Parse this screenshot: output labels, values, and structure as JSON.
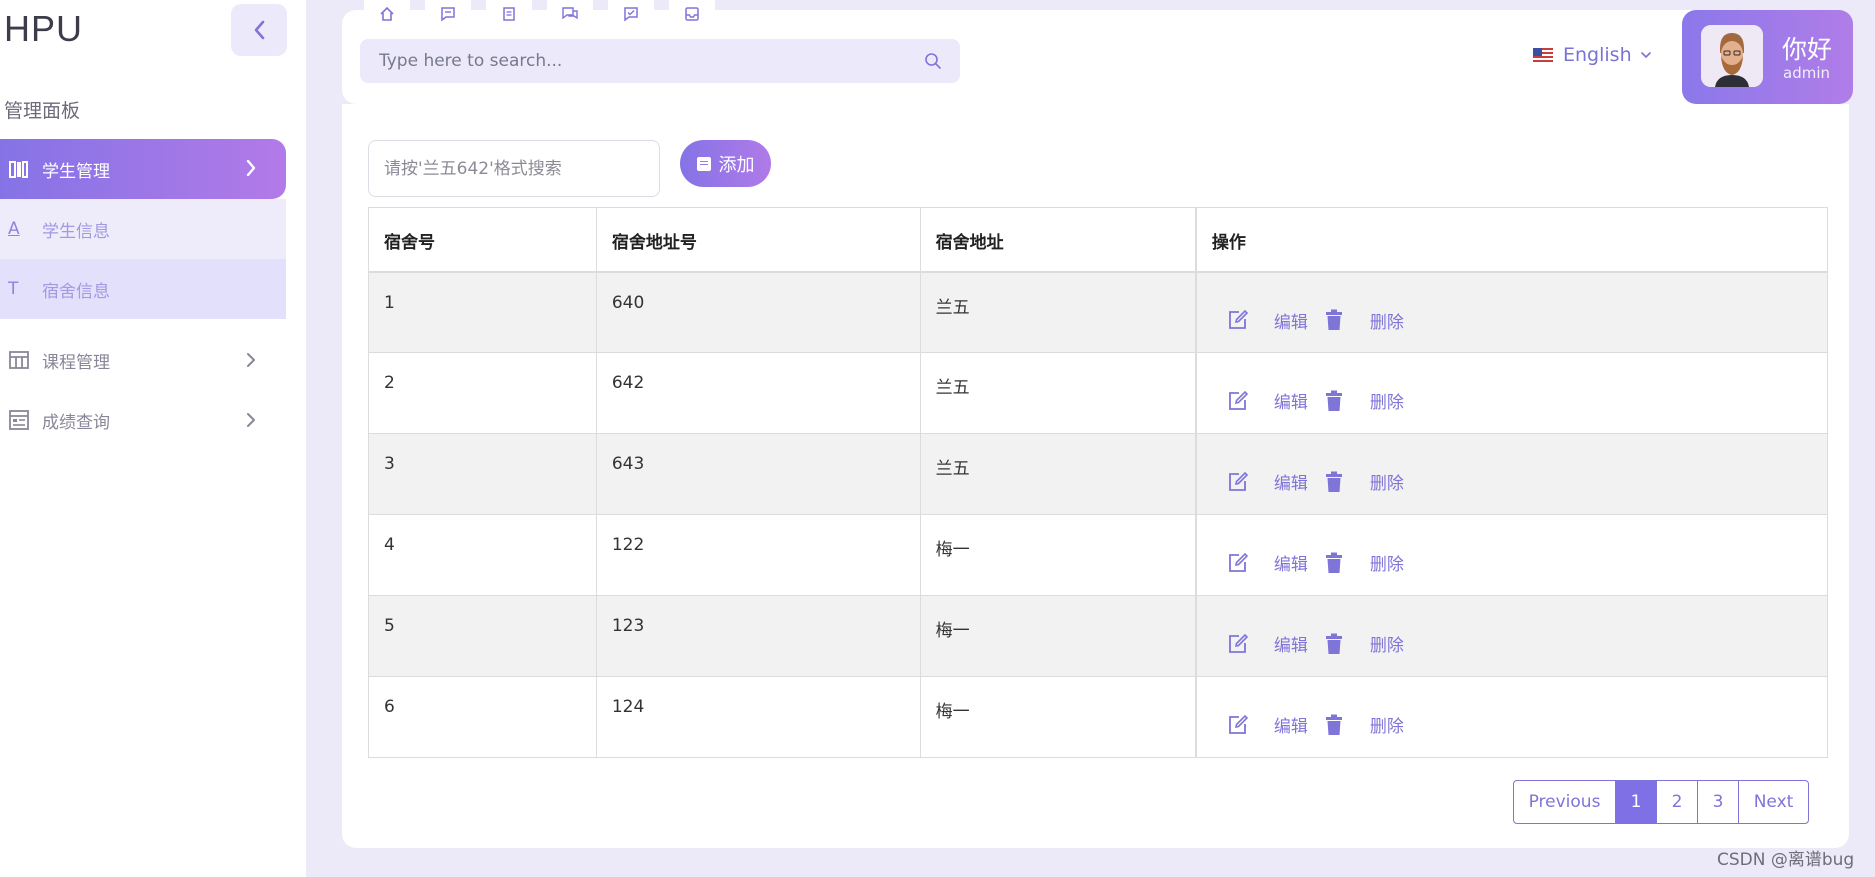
{
  "sidebar": {
    "logo": "HPU",
    "section_title": "管理面板",
    "items": [
      {
        "label": "学生管理",
        "icon": "books-icon"
      },
      {
        "label": "学生信息",
        "icon_char": "A"
      },
      {
        "label": "宿舍信息",
        "icon_char": "T"
      },
      {
        "label": "课程管理",
        "icon": "table-icon"
      },
      {
        "label": "成绩查询",
        "icon": "report-icon"
      }
    ]
  },
  "header": {
    "search_placeholder": "Type here to search...",
    "language": "English",
    "greeting": "你好",
    "username": "admin"
  },
  "toolbar": {
    "filter_placeholder": "请按'兰五642'格式搜索",
    "add_label": "添加"
  },
  "table": {
    "headers": [
      "宿舍号",
      "宿舍地址号",
      "宿舍地址",
      "操作"
    ],
    "rows": [
      {
        "id": "1",
        "addr_no": "640",
        "addr": "兰五"
      },
      {
        "id": "2",
        "addr_no": "642",
        "addr": "兰五"
      },
      {
        "id": "3",
        "addr_no": "643",
        "addr": "兰五"
      },
      {
        "id": "4",
        "addr_no": "122",
        "addr": "梅一"
      },
      {
        "id": "5",
        "addr_no": "123",
        "addr": "梅一"
      },
      {
        "id": "6",
        "addr_no": "124",
        "addr": "梅一"
      }
    ],
    "edit_label": "编辑",
    "delete_label": "删除"
  },
  "pagination": {
    "previous": "Previous",
    "pages": [
      "1",
      "2",
      "3"
    ],
    "current": "1",
    "next": "Next"
  },
  "watermark": "CSDN @离谱bug",
  "colors": {
    "accent": "#8573e6",
    "accent_end": "#b27ae8",
    "background": "#eceaf9"
  }
}
